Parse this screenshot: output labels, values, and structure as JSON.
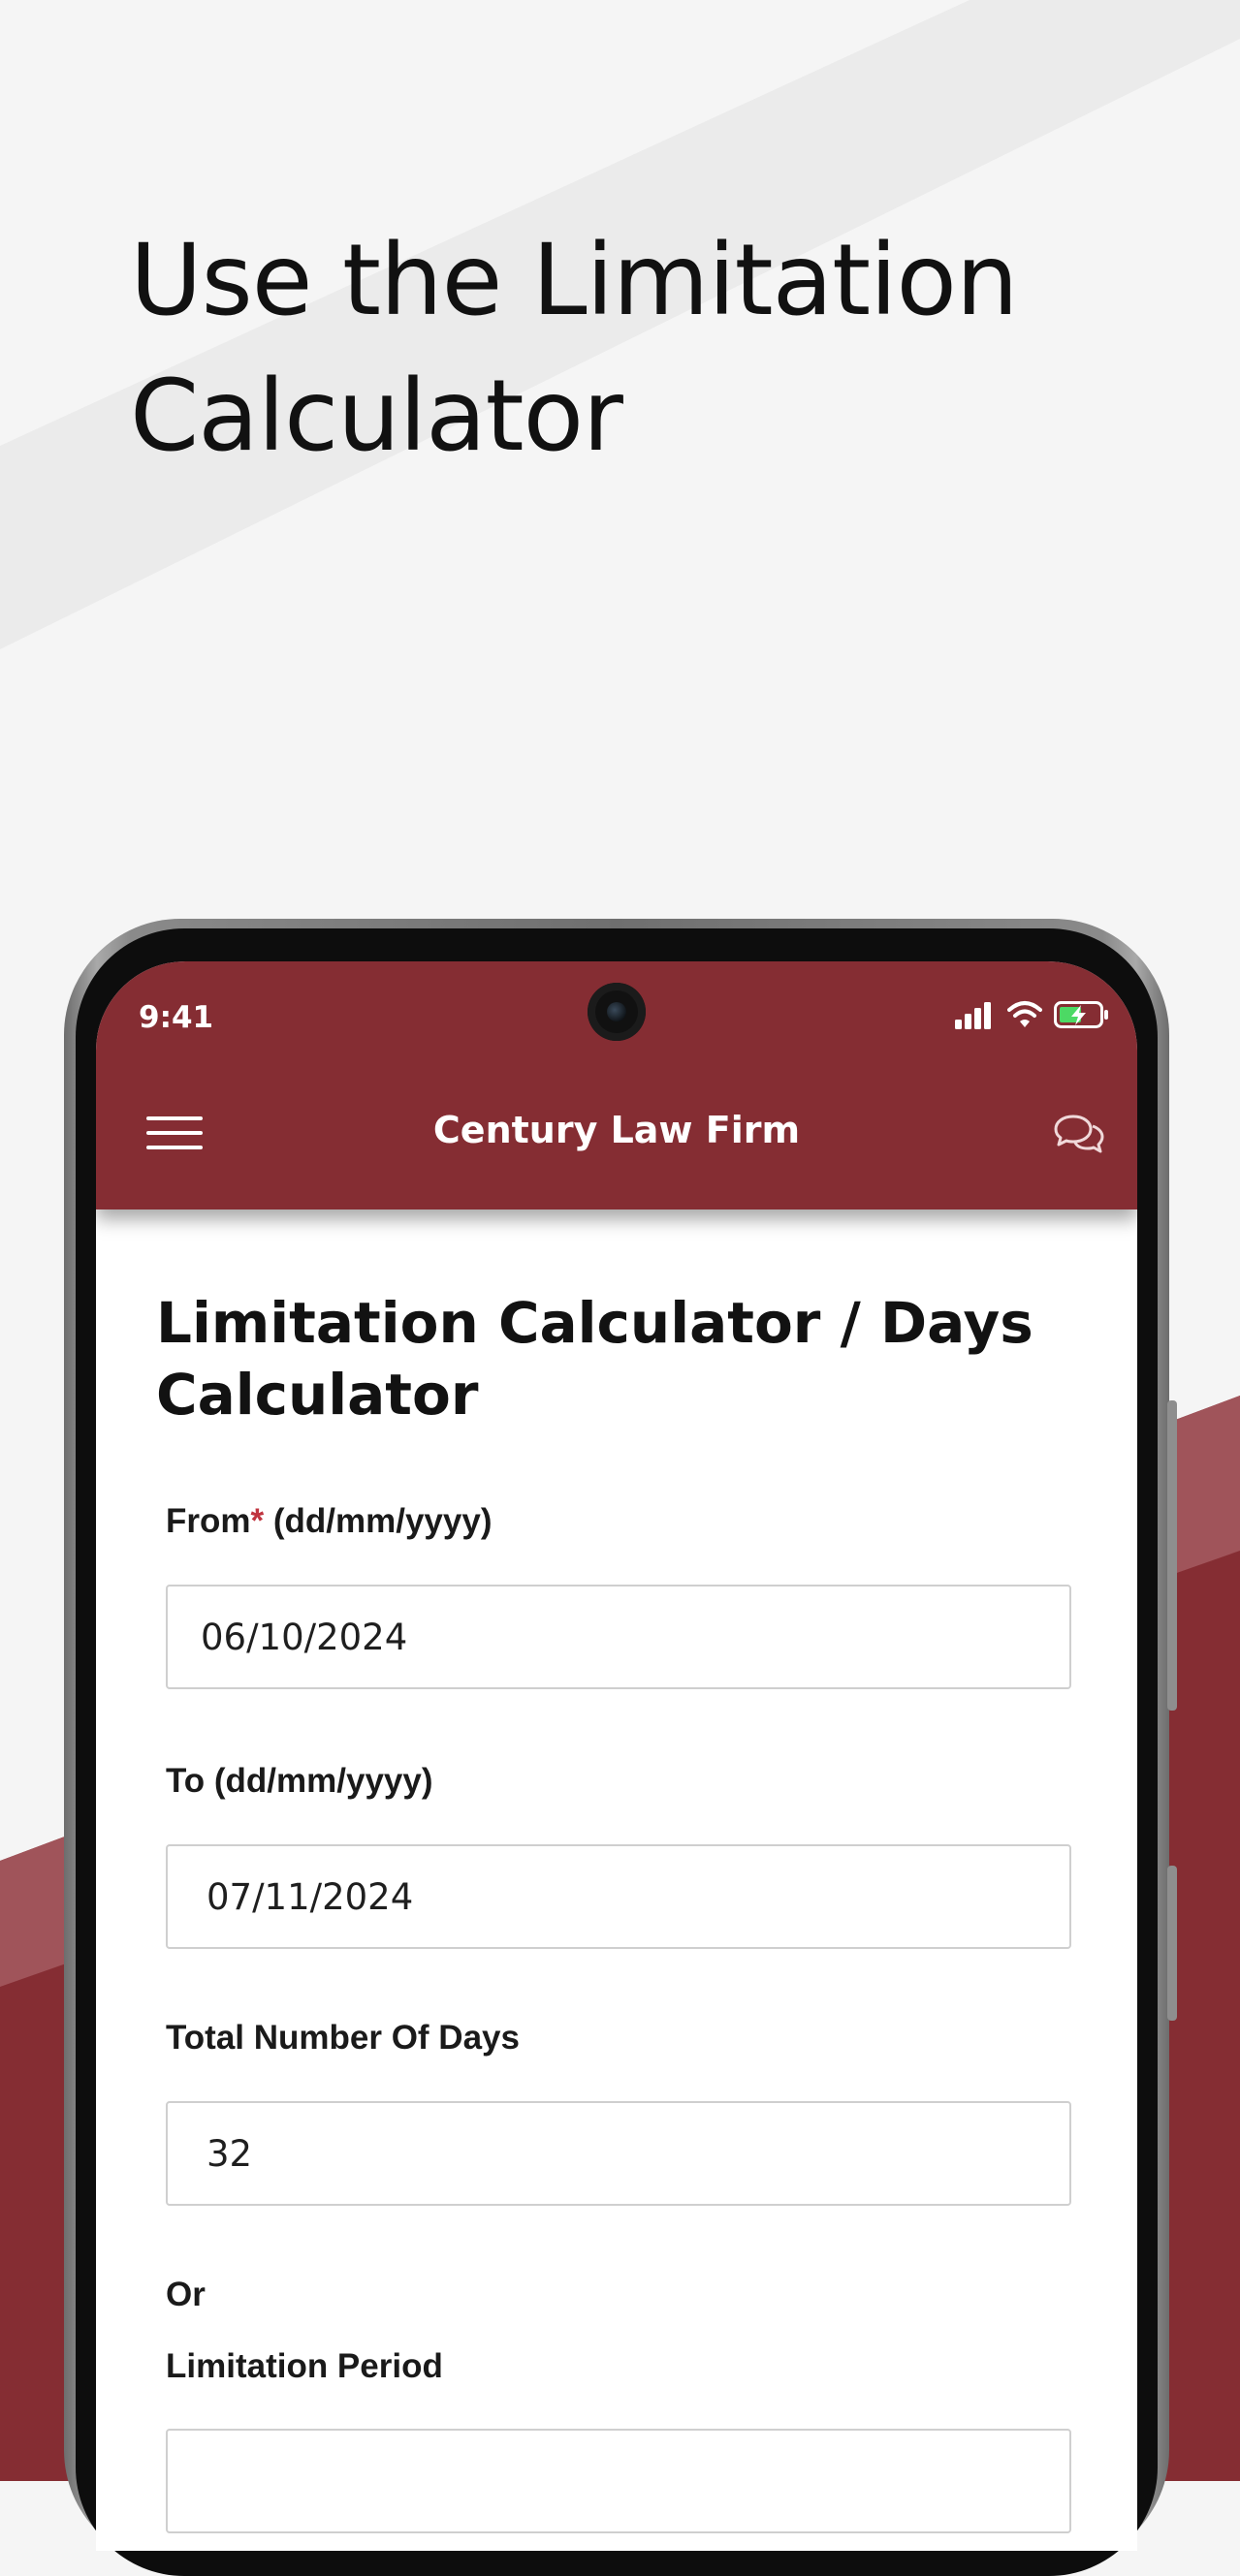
{
  "promo": {
    "headline_line1": "Use the Limitation",
    "headline_line2": "Calculator"
  },
  "colors": {
    "brand": "#852d33",
    "background": "#f5f5f5",
    "accent_stripe": "#9a4a50",
    "required": "#c0343f"
  },
  "status_bar": {
    "time": "9:41",
    "icons": [
      "signal-icon",
      "wifi-icon",
      "battery-charging-icon"
    ]
  },
  "app_header": {
    "title": "Century Law Firm",
    "left_icon": "menu-icon",
    "right_icon": "chat-icon"
  },
  "form": {
    "page_title": "Limitation Calculator / Days Calculator",
    "from": {
      "label": "From",
      "required_mark": "*",
      "format_hint": " (dd/mm/yyyy)",
      "value": "06/10/2024"
    },
    "to": {
      "label": "To (dd/mm/yyyy)",
      "value": "07/11/2024"
    },
    "total_days": {
      "label": "Total Number Of Days",
      "value": "32"
    },
    "or_text": "Or",
    "limitation_period": {
      "label": "Limitation Period",
      "value": ""
    }
  }
}
